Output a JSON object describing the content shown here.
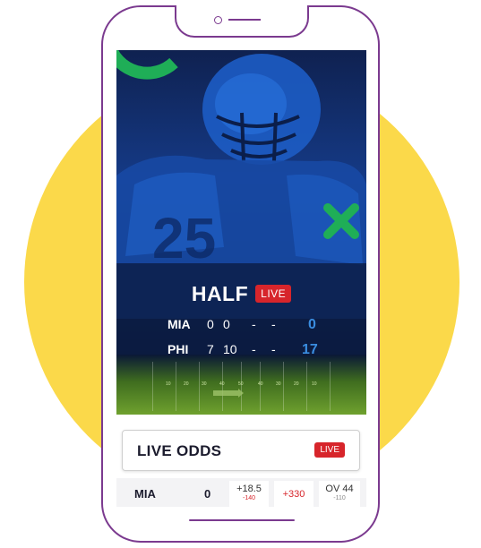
{
  "colors": {
    "accent_purple": "#7b3a8f",
    "background_yellow": "#fbd94a",
    "live_red": "#d7252b",
    "score_blue": "#3a8de0"
  },
  "game": {
    "period": "HALF",
    "live_label": "LIVE",
    "yard_markers": [
      "10",
      "20",
      "30",
      "40",
      "50",
      "40",
      "30",
      "20",
      "10"
    ],
    "teams": [
      {
        "name": "MIA",
        "q1": "0",
        "q2": "0",
        "q3": "-",
        "q4": "-",
        "total": "0"
      },
      {
        "name": "PHI",
        "q1": "7",
        "q2": "10",
        "q3": "-",
        "q4": "-",
        "total": "17"
      }
    ]
  },
  "odds": {
    "title": "LIVE ODDS",
    "live_label": "LIVE",
    "row": {
      "team": "MIA",
      "score": "0",
      "spread": "+18.5",
      "spread_odds": "-140",
      "moneyline": "+330",
      "total": "OV 44",
      "total_odds": "-110"
    }
  }
}
